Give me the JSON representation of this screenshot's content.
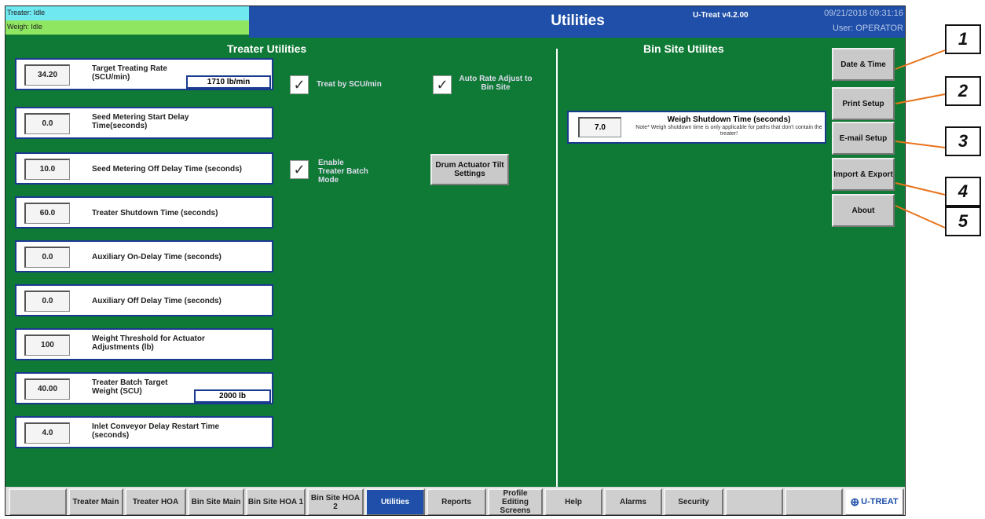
{
  "header": {
    "treater_status": "Treater: Idle",
    "weigh_status": "Weigh: Idle",
    "title": "Utilities",
    "version": "U-Treat v4.2.00",
    "datetime": "09/21/2018 09:31:16",
    "user": "User: OPERATOR"
  },
  "treater": {
    "heading": "Treater Utilities",
    "params": [
      {
        "value": "34.20",
        "label": "Target Treating Rate (SCU/min)",
        "extra": "1710 lb/min"
      },
      {
        "value": "0.0",
        "label": "Seed Metering Start Delay Time(seconds)"
      },
      {
        "value": "10.0",
        "label": "Seed Metering Off Delay Time (seconds)"
      },
      {
        "value": "60.0",
        "label": "Treater Shutdown Time (seconds)"
      },
      {
        "value": "0.0",
        "label": "Auxiliary On-Delay Time (seconds)"
      },
      {
        "value": "0.0",
        "label": "Auxiliary Off Delay Time (seconds)"
      },
      {
        "value": "100",
        "label": "Weight Threshold for Actuator Adjustments (lb)"
      },
      {
        "value": "40.00",
        "label": "Treater Batch Target Weight (SCU)",
        "extra": "2000 lb"
      },
      {
        "value": "4.0",
        "label": "Inlet Conveyor Delay Restart Time (seconds)"
      }
    ],
    "treat_by_scu": {
      "label": "Treat by SCU/min",
      "checked": true
    },
    "auto_rate": {
      "label": "Auto Rate Adjust to Bin Site",
      "checked": true
    },
    "batch_mode": {
      "label": "Enable Treater Batch Mode",
      "checked": true
    },
    "drum_button": "Drum Actuator Tilt Settings"
  },
  "bin_site": {
    "heading": "Bin Site Utilites",
    "weigh_value": "7.0",
    "weigh_title": "Weigh Shutdown Time (seconds)",
    "weigh_note": "Note* Weigh shutdown time is only applicable for paths that don't contain the treater!"
  },
  "side_buttons": [
    "Date & Time",
    "Print Setup",
    "E-mail Setup",
    "Import & Export",
    "About"
  ],
  "tabs": [
    {
      "label": "",
      "state": "disabled"
    },
    {
      "label": "Treater Main",
      "state": "normal"
    },
    {
      "label": "Treater HOA",
      "state": "normal"
    },
    {
      "label": "Bin Site Main",
      "state": "normal"
    },
    {
      "label": "Bin Site HOA 1",
      "state": "normal"
    },
    {
      "label": "Bin Site HOA 2",
      "state": "normal"
    },
    {
      "label": "Utilities",
      "state": "active"
    },
    {
      "label": "Reports",
      "state": "normal"
    },
    {
      "label": "Profile Editing Screens",
      "state": "normal"
    },
    {
      "label": "Help",
      "state": "normal"
    },
    {
      "label": "Alarms",
      "state": "normal"
    },
    {
      "label": "Security",
      "state": "normal"
    },
    {
      "label": "",
      "state": "disabled"
    },
    {
      "label": "",
      "state": "disabled"
    }
  ],
  "logo_text": "U-TREAT",
  "callouts": [
    "1",
    "2",
    "3",
    "4",
    "5"
  ],
  "colors": {
    "screen_bg": "#0f7a35",
    "header": "#1f4fa8",
    "callout_arrow": "#e8731c"
  }
}
